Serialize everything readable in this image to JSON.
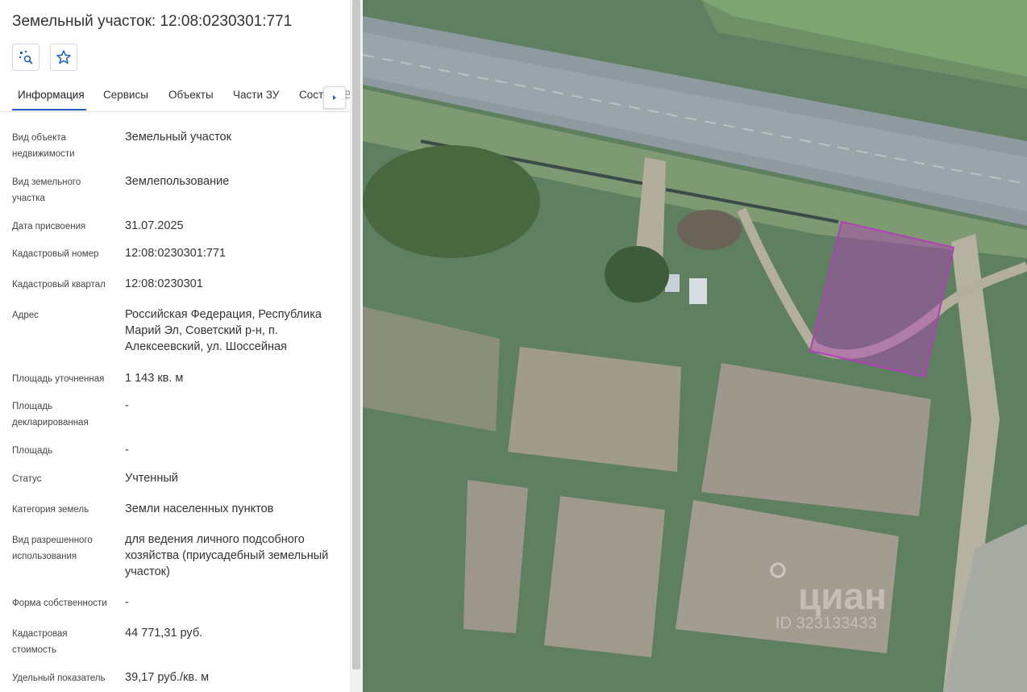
{
  "panel": {
    "title": "Земельный участок: 12:08:0230301:771",
    "buttons": [
      {
        "icon": "map-search-icon"
      },
      {
        "icon": "star-outline-icon"
      }
    ],
    "tabs": [
      "Информация",
      "Сервисы",
      "Объекты",
      "Части ЗУ",
      "Соста"
    ],
    "tab_overflow": "В",
    "active_tab": "Информация",
    "fields": [
      {
        "label": "Вид объекта недвижимости",
        "value": "Земельный участок"
      },
      {
        "label": "Вид земельного участка",
        "value": "Землепользование"
      },
      {
        "label": "Дата присвоения",
        "value": "31.07.2025"
      },
      {
        "label": "Кадастровый номер",
        "value": "12:08:0230301:771"
      },
      {
        "label": "Кадастровый квартал",
        "value": "12:08:0230301"
      },
      {
        "label": "Адрес",
        "value": "Российская Федерация, Республика Марий Эл, Советский р-н, п. Алексеевский, ул. Шоссейная"
      },
      {
        "label": "Площадь уточненная",
        "value": "1 143 кв. м"
      },
      {
        "label": "Площадь декларированная",
        "value": "-"
      },
      {
        "label": "Площадь",
        "value": "-"
      },
      {
        "label": "Статус",
        "value": "Учтенный"
      },
      {
        "label": "Категория земель",
        "value": "Земли населенных пунктов"
      },
      {
        "label": "Вид разрешенного использования",
        "value": "для ведения личного подсобного хозяйства (приусадебный земельный участок)"
      },
      {
        "label": "Форма собственности",
        "value": "-"
      },
      {
        "label": "Кадастровая стоимость",
        "value": "44 771,31 руб."
      },
      {
        "label": "Удельный показатель",
        "value": "39,17 руб./кв. м"
      }
    ]
  },
  "map": {
    "watermark": "циан",
    "watermark_id": "ID 323133433",
    "parcel_color": "#b040b8"
  }
}
